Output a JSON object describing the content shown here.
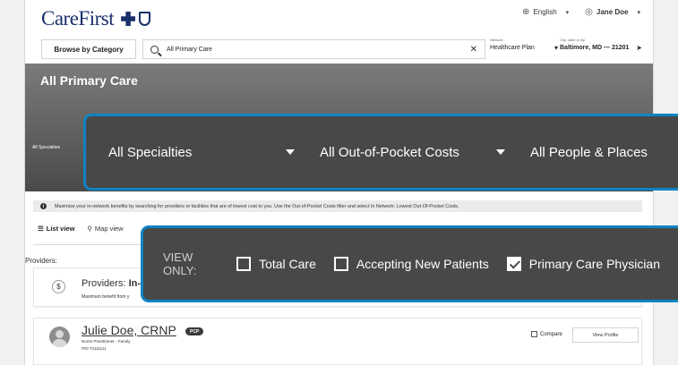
{
  "header": {
    "logo_text": "CareFirst",
    "language": "English",
    "user": "Jane Doe"
  },
  "search_bar": {
    "browse_label": "Browse by Category",
    "query": "All Primary Care",
    "clear_icon": "close-icon",
    "network_label": "Network",
    "network_value": "Healthcare Plan",
    "location_label": "City, state or zip",
    "location_value": "Baltimore, MD — 21201"
  },
  "hero": {
    "title": "All Primary Care",
    "small_filter_label": "All Specialties"
  },
  "filters_callout": {
    "specialties": "All Specialties",
    "costs": "All Out-of-Pocket Costs",
    "people_places": "All People & Places"
  },
  "info_strip": {
    "text": "Maximize your in-network benefits by searching for providers or facilities that are of lowest cost to you. Use the Out-of-Pocket Costs filter and select In Network: Lowest Out-Of-Pocket Costs."
  },
  "views": {
    "list": "List view",
    "map": "Map view"
  },
  "providers": {
    "label": "Providers:",
    "in_network_title_prefix": "Providers: ",
    "in_network_title_bold": "In-",
    "in_network_subtitle": "Maximum benefit from y"
  },
  "view_only_callout": {
    "label": "VIEW ONLY:",
    "options": [
      {
        "label": "Total Care",
        "checked": false
      },
      {
        "label": "Accepting New Patients",
        "checked": false
      },
      {
        "label": "Primary Care Physician",
        "checked": true
      }
    ]
  },
  "provider_card": {
    "name": "Julie Doe, CRNP",
    "badge": "PCP",
    "role": "Nurse Practitioner - Family",
    "pid": "PID T1111111",
    "compare": "Compare",
    "view_profile": "View Profile"
  },
  "colors": {
    "callout_border": "#0f83c4",
    "callout_bg": "#484848",
    "brand": "#1a2f6b"
  }
}
